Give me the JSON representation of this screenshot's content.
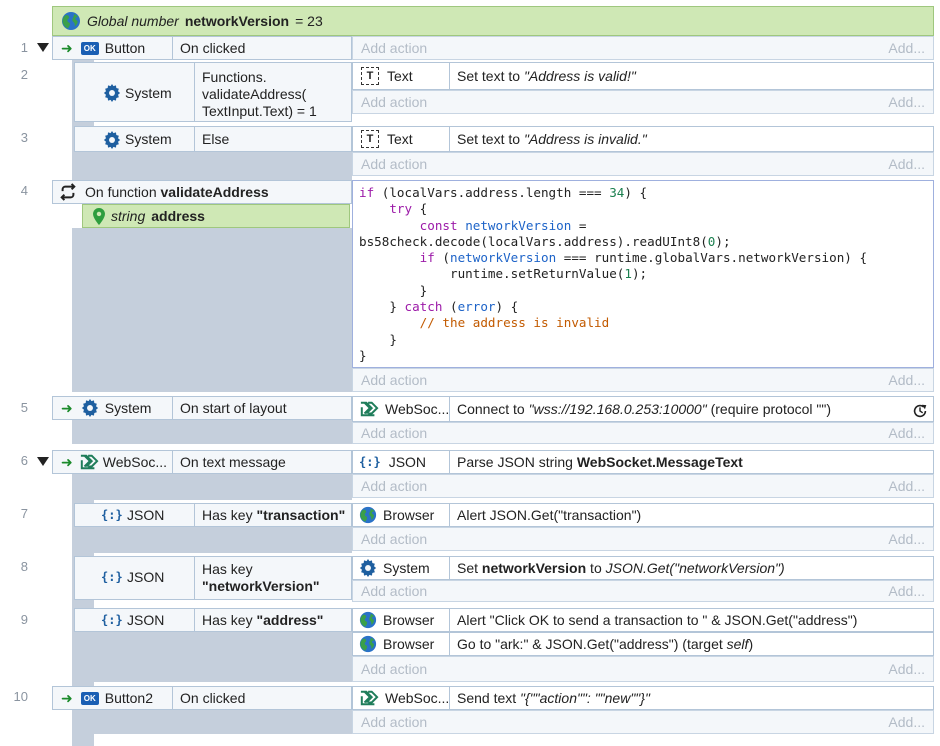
{
  "global": {
    "type_label": "Global number",
    "name": "networkVersion",
    "value_text": "= 23"
  },
  "add_action": "Add action",
  "add_short": "Add...",
  "events": [
    {
      "num": "1",
      "object": "Button",
      "condition": "On clicked",
      "action_obj": "",
      "action": ""
    },
    {
      "num": "2",
      "object": "System",
      "condition_lines": [
        "Functions.",
        "validateAddress(",
        "TextInput.Text) = 1"
      ],
      "action_obj": "Text",
      "action_prefix": "Set text to ",
      "action_italic": "\"Address is valid!\""
    },
    {
      "num": "3",
      "object": "System",
      "condition": "Else",
      "action_obj": "Text",
      "action_prefix": "Set text to ",
      "action_italic": "\"Address is invalid.\""
    },
    {
      "num": "4",
      "title_prefix": "On function ",
      "title_bold": "validateAddress",
      "param_type": "string",
      "param_name": "address"
    },
    {
      "num": "5",
      "object": "System",
      "condition": "On start of layout",
      "action_obj": "WebSoc...",
      "action_prefix": "Connect to ",
      "action_italic": "\"wss://192.168.0.253:10000\"",
      "action_suffix": " (require protocol \"\")"
    },
    {
      "num": "6",
      "object": "WebSoc...",
      "condition": "On text message",
      "action_obj": "JSON",
      "action_prefix": "Parse JSON string ",
      "action_bold": "WebSocket.MessageText"
    },
    {
      "num": "7",
      "object": "JSON",
      "condition_prefix": "Has key ",
      "condition_bold": "\"transaction\"",
      "action_obj": "Browser",
      "action": "Alert JSON.Get(\"transaction\")"
    },
    {
      "num": "8",
      "object": "JSON",
      "condition_prefix": "Has key",
      "condition_bold": "\"networkVersion\"",
      "action_obj": "System",
      "action_prefix": "Set ",
      "action_bold": "networkVersion",
      "action_mid": " to ",
      "action_italic": "JSON.Get(\"networkVersion\")"
    },
    {
      "num": "9",
      "object": "JSON",
      "condition_prefix": "Has key ",
      "condition_bold": "\"address\"",
      "action_obj": "Browser",
      "action": "Alert \"Click OK to send a transaction to \" & JSON.Get(\"address\")",
      "action2_obj": "Browser",
      "action2_prefix": "Go to \"ark:\" & JSON.Get(\"address\") (target ",
      "action2_italic": "self",
      "action2_suffix": ")"
    },
    {
      "num": "10",
      "object": "Button2",
      "condition": "On clicked",
      "action_obj": "WebSoc...",
      "action_prefix": "Send text ",
      "action_italic": "\"{\"\"action\"\": \"\"new\"\"}\""
    }
  ],
  "code_lines": [
    [
      {
        "t": "if",
        "c": "kw"
      },
      {
        "t": " (localVars.address.length === "
      },
      {
        "t": "34",
        "c": "num"
      },
      {
        "t": ") {"
      }
    ],
    [
      {
        "t": "    "
      },
      {
        "t": "try",
        "c": "kw"
      },
      {
        "t": " {"
      }
    ],
    [
      {
        "t": "        "
      },
      {
        "t": "const",
        "c": "kw"
      },
      {
        "t": " "
      },
      {
        "t": "networkVersion",
        "c": "var"
      },
      {
        "t": " ="
      }
    ],
    [
      {
        "t": "bs58check.decode(localVars.address).readUInt8("
      },
      {
        "t": "0",
        "c": "num"
      },
      {
        "t": ");"
      }
    ],
    [
      {
        "t": "        "
      },
      {
        "t": "if",
        "c": "kw"
      },
      {
        "t": " ("
      },
      {
        "t": "networkVersion",
        "c": "var"
      },
      {
        "t": " === runtime.globalVars.networkVersion) {"
      }
    ],
    [
      {
        "t": "            runtime.setReturnValue("
      },
      {
        "t": "1",
        "c": "num"
      },
      {
        "t": ");"
      }
    ],
    [
      {
        "t": "        }"
      }
    ],
    [
      {
        "t": "    } "
      },
      {
        "t": "catch",
        "c": "kw"
      },
      {
        "t": " ("
      },
      {
        "t": "error",
        "c": "var"
      },
      {
        "t": ") {"
      }
    ],
    [
      {
        "t": "        "
      },
      {
        "t": "// the address is invalid",
        "c": "cm"
      }
    ],
    [
      {
        "t": "    }"
      }
    ],
    [
      {
        "t": "}"
      }
    ]
  ],
  "icons": {
    "ok_badge": "OK",
    "json_glyph": "{:}",
    "text_glyph": "T"
  },
  "colors": {
    "green_bar": "#cfe8b5",
    "gutter": "#c5cfdc",
    "keyword": "#9c1aa8",
    "variable": "#1d63c8",
    "number": "#1a7f4e",
    "comment": "#c25a00"
  }
}
